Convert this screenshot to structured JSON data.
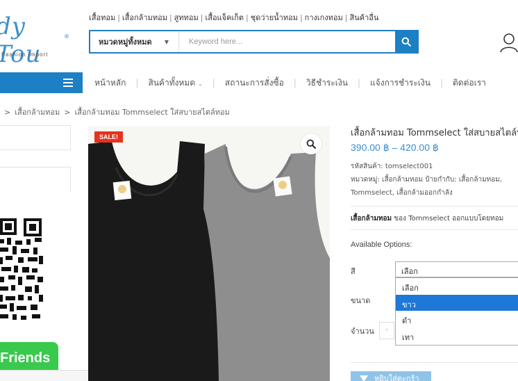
{
  "brand": {
    "script": "dy Tou",
    "tagline": "Fashion Import"
  },
  "toplinks": [
    "เสื้อทอม",
    "เสื้อกล้ามทอม",
    "สูททอม",
    "เสื้อแจ็คเก็ต",
    "ชุดว่ายน้ำทอม",
    "กางเกงทอม",
    "สินค้าอื่น"
  ],
  "search": {
    "category": "หมวดหมู่ทั้งหมด",
    "placeholder": "Keyword here..."
  },
  "nav": {
    "home": "หน้าหลัก",
    "all_products": "สินค้าทั้งหมด",
    "order_status": "สถานะการสั่งซื้อ",
    "payment_method": "วิธีชำระเงิน",
    "payment_notify": "แจ้งการชำระเงิน",
    "contact": "ติดต่อเรา"
  },
  "breadcrumb": {
    "level1": "เสื้อกล้ามทอม",
    "level2": "เสื้อกล้ามทอม Tommselect ใส่สบายสไตล์ทอม"
  },
  "sidebar": {
    "friends_label": "Friends"
  },
  "product": {
    "sale_badge": "SALE!",
    "title": "เสื้อกล้ามทอม Tommselect ใส่สบายสไตล์ทอม",
    "price": "390.00 ฿ – 420.00 ฿",
    "sku_line": "รหัสสินค้า: tomselect001",
    "category_line": "หมวดหมู่: เสื้อกล้ามทอม ป้ายกำกับ: เสื้อกล้ามทอม,",
    "tags_line": "Tommselect, เสื้อกล้ามออกกำลัง",
    "desc_bold": "เสื้อกล้ามทอม",
    "desc_rest": " ของ Tommselect ออกแบบโดยทอม",
    "options_title": "Available Options:",
    "color_label": "สี",
    "size_label": "ขนาด",
    "qty_label": "จำนวน",
    "qty_minus": "-",
    "color_selected": "เลือก",
    "color_options": [
      "เลือก",
      "ขาว",
      "ดำ",
      "เทา"
    ],
    "add_to_cart": "หยิบใส่ตะกร้า"
  },
  "colors": {
    "accent": "#1d7fc4",
    "price": "#3d8fd1",
    "sale": "#e6321f",
    "line_green": "#38c94d",
    "selected_option": "#1e78d7"
  }
}
